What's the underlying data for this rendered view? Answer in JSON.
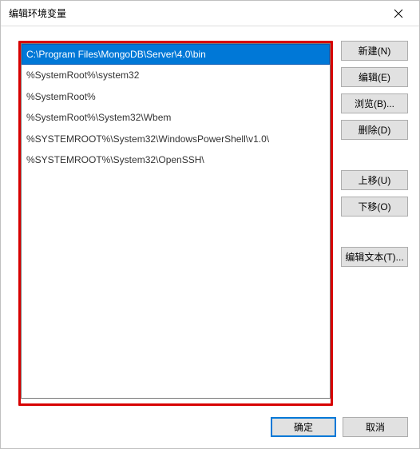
{
  "window": {
    "title": "编辑环境变量"
  },
  "list": {
    "items": [
      "C:\\Program Files\\MongoDB\\Server\\4.0\\bin",
      "%SystemRoot%\\system32",
      "%SystemRoot%",
      "%SystemRoot%\\System32\\Wbem",
      "%SYSTEMROOT%\\System32\\WindowsPowerShell\\v1.0\\",
      "%SYSTEMROOT%\\System32\\OpenSSH\\"
    ],
    "selected_index": 0
  },
  "buttons": {
    "new": "新建(N)",
    "edit": "编辑(E)",
    "browse": "浏览(B)...",
    "delete": "删除(D)",
    "move_up": "上移(U)",
    "move_down": "下移(O)",
    "edit_text": "编辑文本(T)...",
    "ok": "确定",
    "cancel": "取消"
  }
}
